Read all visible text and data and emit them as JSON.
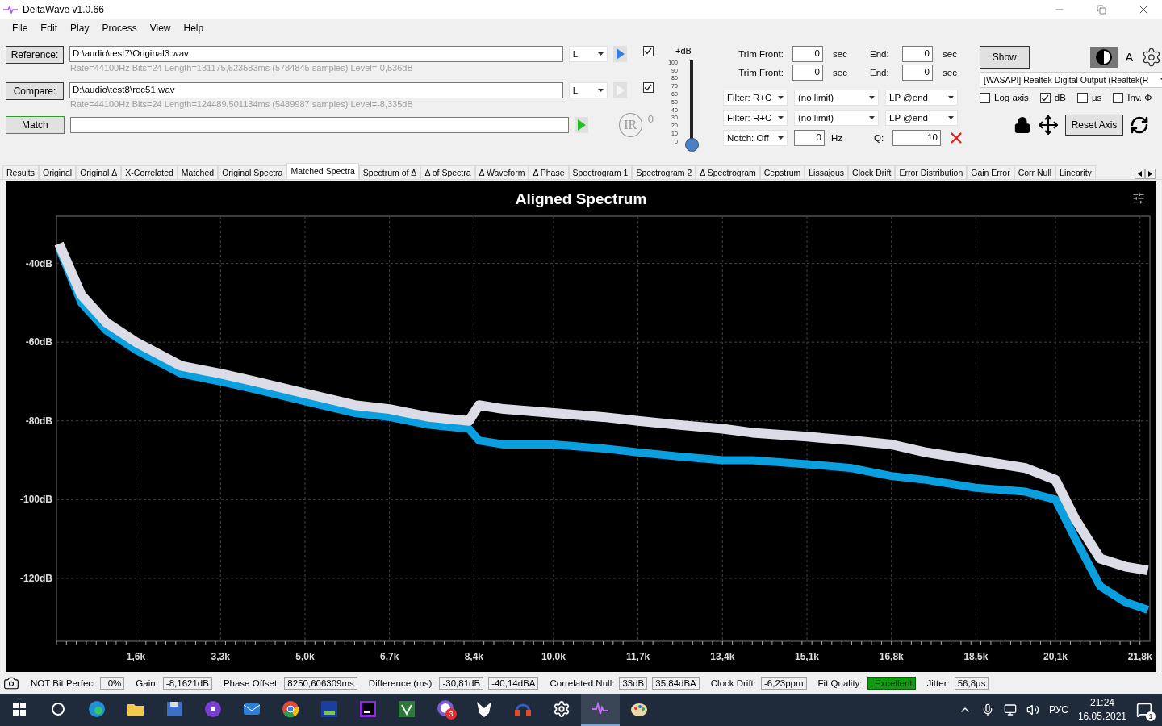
{
  "window": {
    "title": "DeltaWave v1.0.66"
  },
  "menu": [
    "File",
    "Edit",
    "Play",
    "Process",
    "View",
    "Help"
  ],
  "files": [
    {
      "button": "Reference:",
      "path": "D:\\audio\\test7\\Original3.wav",
      "info": "Rate=44100Hz Bits=24 Length=131175,623583ms (5784845 samples) Level=-0,536dB",
      "channel": "L",
      "play_enabled": true,
      "checked": true
    },
    {
      "button": "Compare:",
      "path": "D:\\audio\\test8\\rec51.wav",
      "info": "Rate=44100Hz Bits=24 Length=124489,501134ms (5489987 samples) Level=-8,335dB",
      "channel": "L",
      "play_enabled": false,
      "checked": true
    }
  ],
  "match": {
    "button": "Match",
    "ir_label": "IR",
    "ir_count": "0"
  },
  "meter": {
    "label": "+dB",
    "ticks": [
      "100",
      "90",
      "80",
      "70",
      "60",
      "50",
      "40",
      "30",
      "20",
      "10",
      "0"
    ],
    "level": 0
  },
  "trim": [
    {
      "label": "Trim Front:",
      "value": "0",
      "unit": "sec",
      "end_label": "End:",
      "end_value": "0",
      "end_unit": "sec"
    },
    {
      "label": "Trim Front:",
      "value": "0",
      "unit": "sec",
      "end_label": "End:",
      "end_value": "0",
      "end_unit": "sec"
    }
  ],
  "filters": [
    [
      "Filter: R+C",
      "(no limit)",
      "LP @end"
    ],
    [
      "Filter: R+C",
      "(no limit)",
      "LP @end"
    ]
  ],
  "notch": {
    "mode": "Notch: Off",
    "value": "0",
    "unit": "Hz",
    "q_label": "Q:",
    "q_value": "10"
  },
  "right": {
    "show_button": "Show",
    "font_label": "A",
    "device": "[WASAPI] Realtek Digital Output (Realtek(R",
    "reset_button": "Reset Axis",
    "options": [
      {
        "label": "Log axis",
        "checked": false
      },
      {
        "label": "dB",
        "checked": true
      },
      {
        "label": "µs",
        "checked": false
      },
      {
        "label": "Inv. Φ",
        "checked": false
      }
    ]
  },
  "tabs": [
    {
      "label": "Results",
      "selected": false
    },
    {
      "label": "Original",
      "selected": false
    },
    {
      "label": "Original Δ",
      "selected": false
    },
    {
      "label": "X-Correlated",
      "selected": false
    },
    {
      "label": "Matched",
      "selected": false
    },
    {
      "label": "Original Spectra",
      "selected": false
    },
    {
      "label": "Matched Spectra",
      "selected": true
    },
    {
      "label": "Spectrum of Δ",
      "selected": false
    },
    {
      "label": "Δ of Spectra",
      "selected": false
    },
    {
      "label": "Δ Waveform",
      "selected": false
    },
    {
      "label": "Δ Phase",
      "selected": false
    },
    {
      "label": "Spectrogram 1",
      "selected": false
    },
    {
      "label": "Spectrogram 2",
      "selected": false
    },
    {
      "label": "Δ Spectrogram",
      "selected": false
    },
    {
      "label": "Cepstrum",
      "selected": false
    },
    {
      "label": "Lissajous",
      "selected": false
    },
    {
      "label": "Clock Drift",
      "selected": false
    },
    {
      "label": "Error Distribution",
      "selected": false
    },
    {
      "label": "Gain Error",
      "selected": false
    },
    {
      "label": "Corr Null",
      "selected": false
    },
    {
      "label": "Linearity",
      "selected": false
    }
  ],
  "chart": {
    "chart_data": {
      "type": "line",
      "title": "Aligned Spectrum",
      "grid": true,
      "xlim": [
        0,
        22
      ],
      "ylim": [
        -136,
        -28
      ],
      "x": [
        0.05,
        0.5,
        1,
        1.6,
        2.5,
        3.3,
        4,
        5,
        6,
        6.7,
        7.5,
        8.3,
        8.5,
        9,
        10,
        11,
        11.7,
        12.5,
        13.4,
        14,
        15.1,
        16,
        16.8,
        17.5,
        18.5,
        19.5,
        20.1,
        20.5,
        21,
        21.5,
        21.96
      ],
      "xticks": [
        {
          "value": 1.6,
          "label": "1,6k"
        },
        {
          "value": 3.3,
          "label": "3,3k"
        },
        {
          "value": 5.0,
          "label": "5,0k"
        },
        {
          "value": 6.7,
          "label": "6,7k"
        },
        {
          "value": 8.4,
          "label": "8,4k"
        },
        {
          "value": 10.0,
          "label": "10,0k"
        },
        {
          "value": 11.7,
          "label": "11,7k"
        },
        {
          "value": 13.4,
          "label": "13,4k"
        },
        {
          "value": 15.1,
          "label": "15,1k"
        },
        {
          "value": 16.8,
          "label": "16,8k"
        },
        {
          "value": 18.5,
          "label": "18,5k"
        },
        {
          "value": 20.1,
          "label": "20,1k"
        },
        {
          "value": 21.8,
          "label": "21,8k"
        }
      ],
      "yticks": [
        {
          "value": -40,
          "label": "-40dB"
        },
        {
          "value": -60,
          "label": "-60dB"
        },
        {
          "value": -80,
          "label": "-80dB"
        },
        {
          "value": -100,
          "label": "-100dB"
        },
        {
          "value": -120,
          "label": "-120dB"
        }
      ],
      "series": [
        {
          "color": "#0aa0e0",
          "values": [
            -36,
            -50,
            -57,
            -62,
            -68,
            -70,
            -72,
            -75,
            -78,
            -79,
            -81,
            -82,
            -85,
            -86,
            -86,
            -87,
            -88,
            -89,
            -90,
            -90,
            -91,
            -92,
            -94,
            -95,
            -97,
            -98,
            -100,
            -110,
            -122,
            -126,
            -128
          ]
        },
        {
          "color": "#dcdce6",
          "values": [
            -35,
            -48,
            -55,
            -60,
            -66,
            -68,
            -70,
            -73,
            -76,
            -77,
            -79,
            -80,
            -76,
            -77,
            -78,
            -79,
            -80,
            -81,
            -82,
            -83,
            -84,
            -85,
            -86,
            -88,
            -90,
            -92,
            -95,
            -105,
            -115,
            -117,
            -118
          ]
        }
      ]
    }
  },
  "status": [
    {
      "label": "NOT Bit Perfect",
      "values": [
        "0%"
      ],
      "kind": "plain"
    },
    {
      "label": "Gain:",
      "values": [
        "-8,1621dB"
      ],
      "kind": "plain"
    },
    {
      "label": "Phase Offset:",
      "values": [
        "8250,606309ms"
      ],
      "kind": "plain"
    },
    {
      "label": "Difference (ms):",
      "values": [
        "-30,81dB",
        "-40,14dBA"
      ],
      "kind": "plain"
    },
    {
      "label": "Correlated Null:",
      "values": [
        "33dB",
        "35,84dBA"
      ],
      "kind": "plain"
    },
    {
      "label": "Clock Drift:",
      "values": [
        "-6,23ppm"
      ],
      "kind": "plain"
    },
    {
      "label": "Fit Quality:",
      "values": [
        "Excellent"
      ],
      "kind": "quality"
    },
    {
      "label": "Jitter:",
      "values": [
        "56,8µs"
      ],
      "kind": "plain"
    }
  ],
  "taskbar": {
    "apps": [
      {
        "kind": "search",
        "active": false
      },
      {
        "kind": "edge",
        "active": false
      },
      {
        "kind": "folder",
        "active": false
      },
      {
        "kind": "disk",
        "active": false
      },
      {
        "kind": "podcast",
        "active": false
      },
      {
        "kind": "mail",
        "active": false
      },
      {
        "kind": "chrome",
        "active": false
      },
      {
        "kind": "ap2",
        "active": false
      },
      {
        "kind": "ide",
        "active": false
      },
      {
        "kind": "vee",
        "active": false
      },
      {
        "kind": "viber",
        "active": false,
        "badge": "3"
      },
      {
        "kind": "fox",
        "active": false
      },
      {
        "kind": "headphones",
        "active": false
      },
      {
        "kind": "gear",
        "active": false
      },
      {
        "kind": "wave",
        "active": true
      },
      {
        "kind": "palette",
        "active": false
      }
    ],
    "language": "РУС",
    "time": "21:24",
    "date": "16.05.2021",
    "notifications": "1"
  }
}
